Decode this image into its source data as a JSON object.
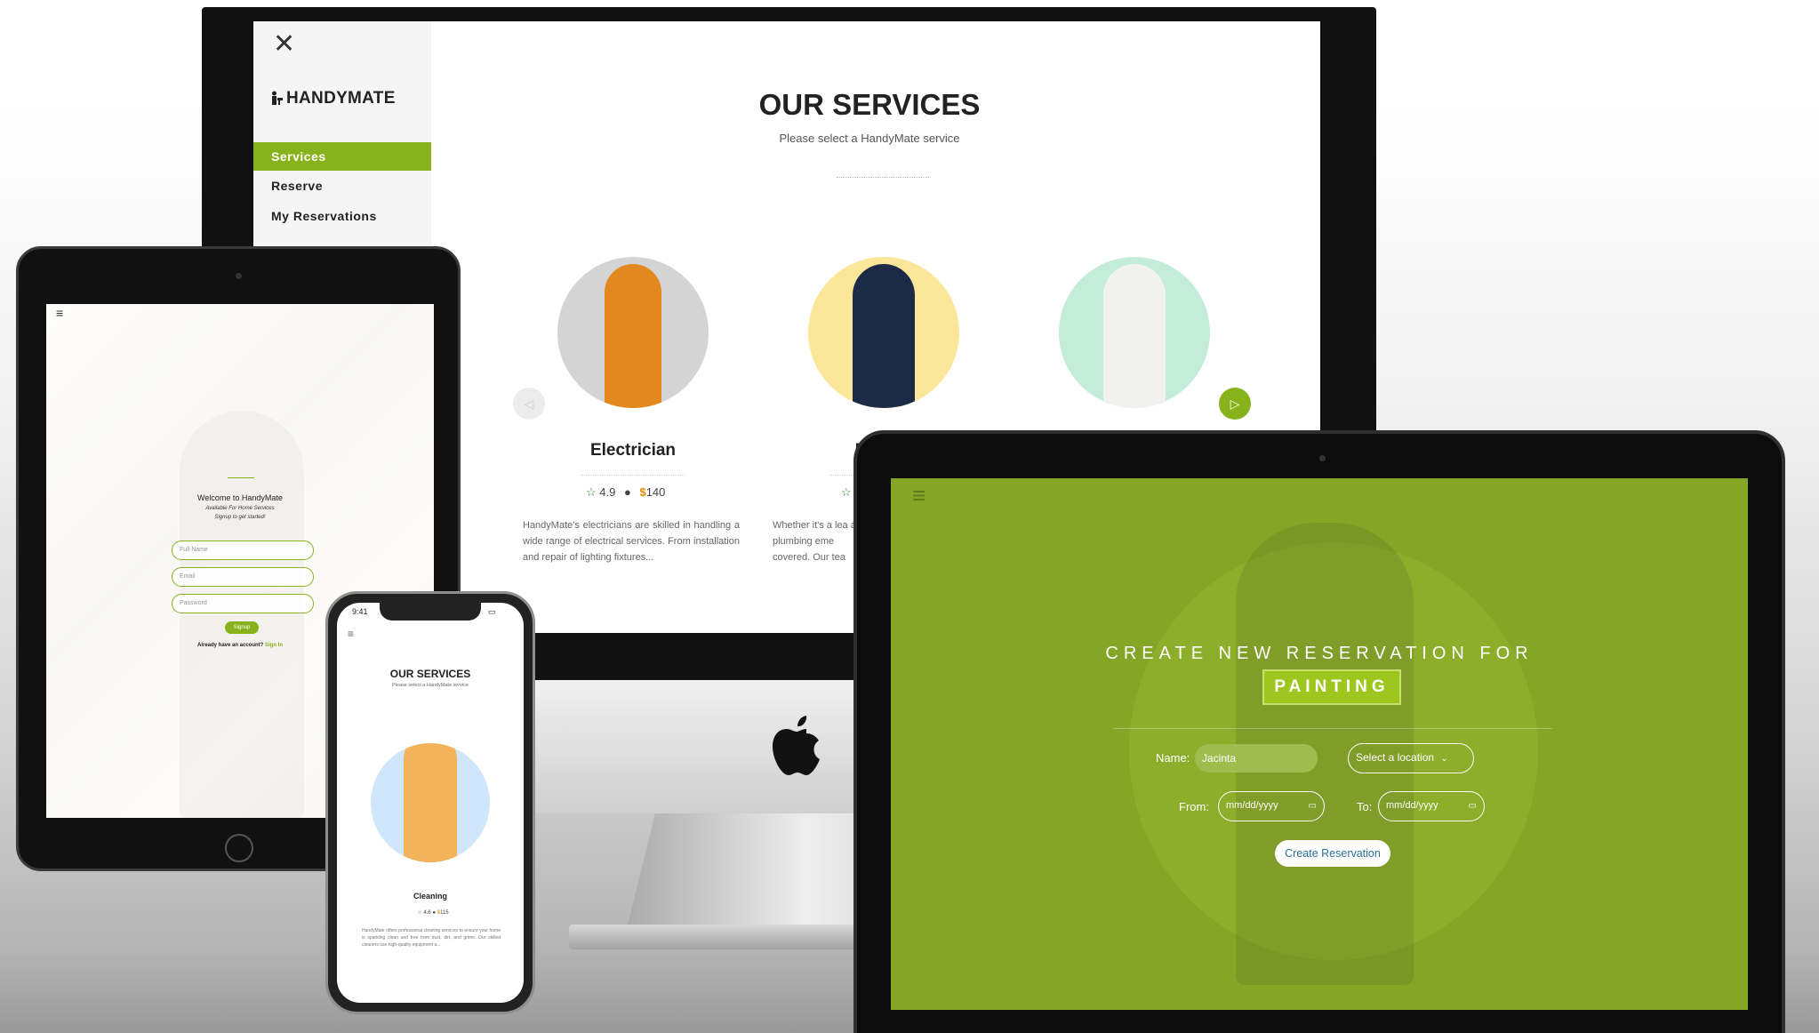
{
  "imac": {
    "close_glyph": "✕",
    "logo": "HANDYMATE",
    "nav": [
      "Services",
      "Reserve",
      "My Reservations"
    ],
    "title": "OUR SERVICES",
    "subtitle": "Please select a HandyMate service",
    "services": [
      {
        "name": "Electrician",
        "rating": "4.9",
        "price": "140",
        "description": "HandyMate's electricians are skilled in handling a wide range of electrical services. From installation and repair of lighting fixtures..."
      },
      {
        "name": "P",
        "description": "Whether it's a lea a plumbing eme covered. Our tea"
      }
    ]
  },
  "ipad": {
    "menu_glyph": "≡",
    "welcome": "Welcome to HandyMate",
    "tagline": "Available For Home Services",
    "subtagline": "Signup to get started!",
    "placeholders": [
      "Full Name",
      "Email",
      "Password"
    ],
    "signup_button": "Signup",
    "account_prompt": "Already have an account?",
    "signin_link": "Sign In"
  },
  "iphone": {
    "time": "9:41",
    "menu_glyph": "≡",
    "title": "OUR SERVICES",
    "subtitle": "Please select a HandyMate service",
    "service": {
      "name": "Cleaning",
      "rating": "4.6",
      "price": "115",
      "description": "HandyMate offers professional cleaning services to ensure your home is sparkling clean and free from dust, dirt, and grime. Our skilled cleaners use high-quality equipment a..."
    }
  },
  "macbook": {
    "menu_glyph": "≡",
    "heading": "CREATE NEW RESERVATION FOR",
    "service": "PAINTING",
    "name_label": "Name:",
    "name_value": "Jacinta",
    "location_select": "Select a location",
    "from_label": "From:",
    "to_label": "To:",
    "date_placeholder": "mm/dd/yyyy",
    "submit": "Create Reservation"
  },
  "colors": {
    "accent": "#87b21b",
    "macbook_bg": "#84a626",
    "price": "#e08a00"
  },
  "icons": [
    "close-icon",
    "menu-icon",
    "star-icon",
    "dollar-icon",
    "chevron-left-icon",
    "play-icon",
    "calendar-icon",
    "chevron-down-icon",
    "apple-logo-icon"
  ]
}
